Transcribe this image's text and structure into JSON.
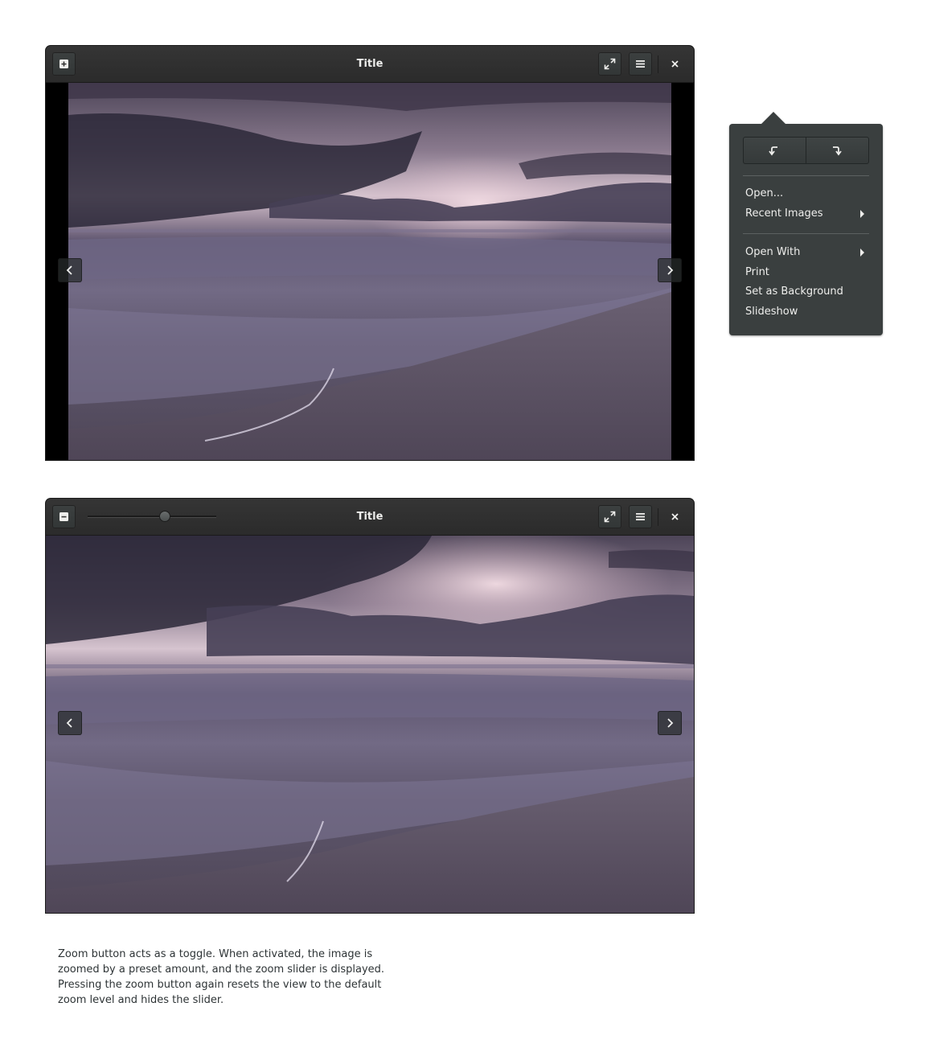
{
  "window_top": {
    "title": "Title",
    "zoom_button_state": "off"
  },
  "window_bottom": {
    "title": "Title",
    "zoom_button_state": "on",
    "zoom_slider_level": 0.6
  },
  "popover": {
    "rotate_left_icon": "rotate-left-icon",
    "rotate_right_icon": "rotate-right-icon",
    "items": [
      {
        "label": "Open...",
        "has_submenu": false
      },
      {
        "label": "Recent Images",
        "has_submenu": true
      },
      {
        "label": "Open With",
        "has_submenu": true
      },
      {
        "label": "Print",
        "has_submenu": false
      },
      {
        "label": "Set as Background",
        "has_submenu": false
      },
      {
        "label": "Slideshow",
        "has_submenu": false
      }
    ]
  },
  "icons": {
    "zoom_in": "zoom-in-icon",
    "zoom_out": "zoom-out-icon",
    "fullscreen": "fullscreen-icon",
    "menu": "hamburger-menu-icon",
    "close": "close-icon",
    "previous": "chevron-left-icon",
    "next": "chevron-right-icon"
  },
  "colors": {
    "headerbar": "#2d2d2d",
    "popover_bg": "#3a3f3f",
    "text_light": "#eeeeec",
    "caption_text": "#2e3436"
  },
  "caption": "Zoom button acts as a toggle. When activated, the image is zoomed by a preset amount, and the zoom slider is displayed. Pressing the zoom button again resets the view to the default zoom level and hides the slider."
}
